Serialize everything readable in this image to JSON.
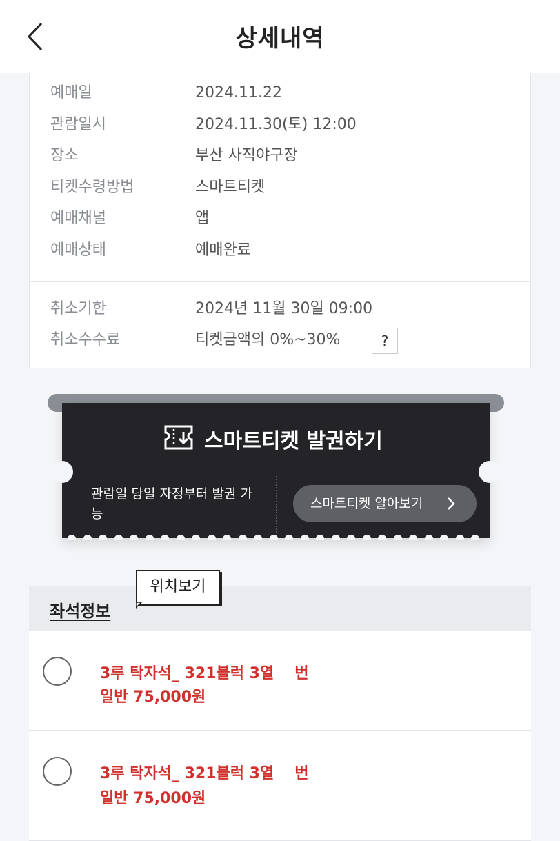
{
  "header": {
    "title": "상세내역",
    "back_icon": "chevron-left-icon"
  },
  "booking_info": {
    "rows": [
      {
        "label": "예매일",
        "value": "2024.11.22"
      },
      {
        "label": "관람일시",
        "value": "2024.11.30(토) 12:00"
      },
      {
        "label": "장소",
        "value": "부산 사직야구장"
      },
      {
        "label": "티켓수령방법",
        "value": "스마트티켓"
      },
      {
        "label": "예매채널",
        "value": "앱"
      },
      {
        "label": "예매상태",
        "value": "예매완료"
      }
    ],
    "cancel_rows": [
      {
        "label": "취소기한",
        "value": "2024년 11월 30일 09:00"
      },
      {
        "label": "취소수수료",
        "value": "티켓금액의 0%~30%"
      }
    ],
    "help_label": "?"
  },
  "smart_ticket": {
    "title": "스마트티켓 발권하기",
    "icon": "ticket-download-icon",
    "note": "관람일 당일 자정부터 발권 가능",
    "learn_more": "스마트티켓 알아보기"
  },
  "seat_info": {
    "title": "좌석정보",
    "tooltip": "위치보기",
    "seats": [
      {
        "section": "3루 탁자석_ 321블럭 3열",
        "number_suffix": "번",
        "price": "일반 75,000원"
      },
      {
        "section": "3루 탁자석_ 321블럭 3열",
        "number_suffix": "번",
        "price": "일반 75,000원"
      }
    ]
  },
  "colors": {
    "accent_red": "#d0312d",
    "ticket_bg": "#242428",
    "page_bg": "#f4f5f8"
  }
}
